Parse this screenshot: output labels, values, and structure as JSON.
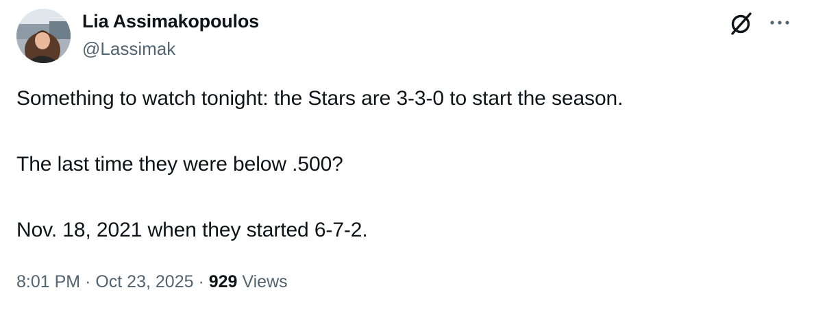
{
  "author": {
    "name": "Lia Assimakopoulos",
    "handle": "@Lassimak"
  },
  "icons": {
    "avatar": "profile-photo",
    "grok": "grok-slash-icon",
    "more": "more-horizontal-icon"
  },
  "tweet": {
    "lines": [
      "Something to watch tonight: the Stars are 3-3-0 to start the season.",
      "The last time they were below .500?",
      "Nov. 18, 2021 when they started 6-7-2."
    ]
  },
  "meta": {
    "time": "8:01 PM",
    "separator": "·",
    "date": "Oct 23, 2025",
    "views_count": "929",
    "views_label": "Views"
  },
  "colors": {
    "text": "#0f1419",
    "secondary": "#536471",
    "background": "#ffffff"
  }
}
